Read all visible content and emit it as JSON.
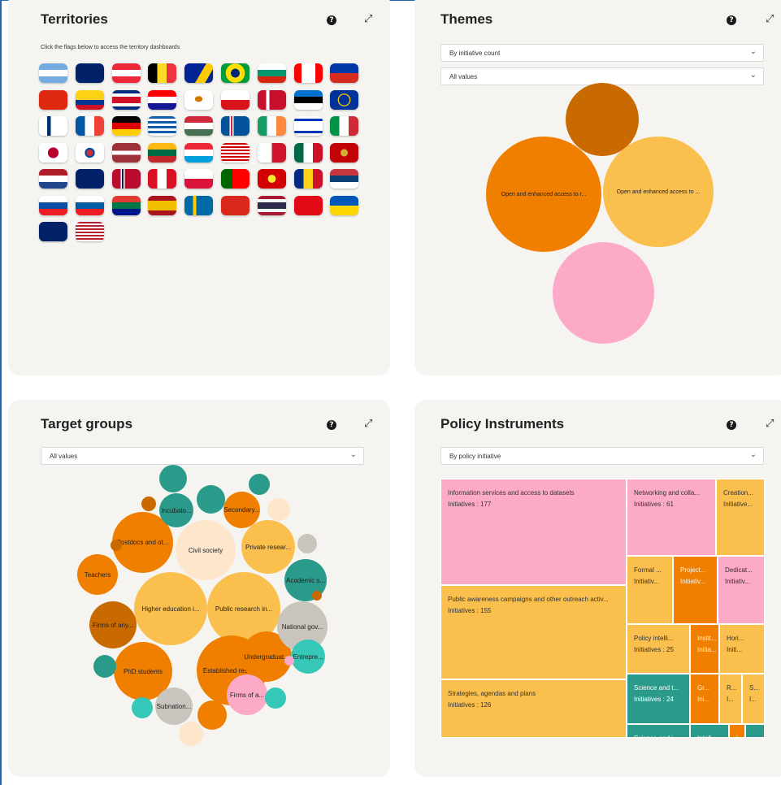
{
  "territories": {
    "title": "Territories",
    "hint": "Click the flags below to access the territory dashboards",
    "flags": [
      {
        "name": "flag-argentina",
        "bg": "linear-gradient(#74acdf 33%,#fff 33% 66%,#74acdf 66%)"
      },
      {
        "name": "flag-australia",
        "bg": "#012169"
      },
      {
        "name": "flag-austria",
        "bg": "linear-gradient(#ed2939 33%,#fff 33% 66%,#ed2939 66%)"
      },
      {
        "name": "flag-belgium",
        "bg": "linear-gradient(90deg,#000 33%,#fdda24 33% 66%,#ef3340 66%)"
      },
      {
        "name": "flag-bosnia",
        "bg": "linear-gradient(120deg,#002395 55%,#fecb00 55% 80%,#002395 80%)"
      },
      {
        "name": "flag-brazil",
        "bg": "radial-gradient(circle,#002776 25%,#fedf00 26% 55%,#009c3b 56%)"
      },
      {
        "name": "flag-bulgaria",
        "bg": "linear-gradient(#fff 33%,#00966e 33% 66%,#d62612 66%)"
      },
      {
        "name": "flag-canada",
        "bg": "linear-gradient(90deg,#ff0000 25%,#fff 25% 75%,#ff0000 75%)"
      },
      {
        "name": "flag-chile",
        "bg": "linear-gradient(#0039a6 50%,#d52b1e 50%)"
      },
      {
        "name": "flag-china",
        "bg": "#de2910"
      },
      {
        "name": "flag-colombia",
        "bg": "linear-gradient(#fcd116 50%,#003893 50% 75%,#ce1126 75%)"
      },
      {
        "name": "flag-costa-rica",
        "bg": "linear-gradient(#002b7f 17%,#fff 17% 33%,#ce1126 33% 67%,#fff 67% 83%,#002b7f 83%)"
      },
      {
        "name": "flag-croatia",
        "bg": "linear-gradient(#ff0000 33%,#fff 33% 66%,#171796 66%)"
      },
      {
        "name": "flag-cyprus",
        "bg": "radial-gradient(ellipse at 50% 45%,#d57800 18%,#fff 20%)"
      },
      {
        "name": "flag-czechia",
        "bg": "linear-gradient(#fff 50%,#d7141a 50%)"
      },
      {
        "name": "flag-denmark",
        "bg": "linear-gradient(90deg,#c8102e 30%,#fff 30% 42%,#c8102e 42%)"
      },
      {
        "name": "flag-estonia",
        "bg": "linear-gradient(#0072ce 33%,#000 33% 66%,#fff 66%)"
      },
      {
        "name": "flag-eu",
        "bg": "radial-gradient(circle,#003399 30%,#ffcc00 32% 36%,#003399 38%)"
      },
      {
        "name": "flag-finland",
        "bg": "linear-gradient(90deg,#fff 28%,#002f6c 28% 42%,#fff 42%)"
      },
      {
        "name": "flag-france",
        "bg": "linear-gradient(90deg,#0055a4 33%,#fff 33% 66%,#ef4135 66%)"
      },
      {
        "name": "flag-germany",
        "bg": "linear-gradient(#000 33%,#dd0000 33% 66%,#ffce00 66%)"
      },
      {
        "name": "flag-greece",
        "bg": "repeating-linear-gradient(#0d5eaf 0 3px,#fff 3px 6px)"
      },
      {
        "name": "flag-hungary",
        "bg": "linear-gradient(#ce2939 33%,#fff 33% 66%,#477050 66%)"
      },
      {
        "name": "flag-iceland",
        "bg": "linear-gradient(90deg,#02529c 30%,#fff 30% 34%,#dc1e35 34% 40%,#fff 40% 44%,#02529c 44%)"
      },
      {
        "name": "flag-ireland",
        "bg": "linear-gradient(90deg,#169b62 33%,#fff 33% 66%,#ff883e 66%)"
      },
      {
        "name": "flag-israel",
        "bg": "linear-gradient(#fff 12%,#0038b8 12% 24%,#fff 24% 76%,#0038b8 76% 88%,#fff 88%)"
      },
      {
        "name": "flag-italy",
        "bg": "linear-gradient(90deg,#009246 33%,#fff 33% 66%,#ce2b37 66%)"
      },
      {
        "name": "flag-japan",
        "bg": "radial-gradient(circle,#bc002d 30%,#fff 32%)"
      },
      {
        "name": "flag-korea",
        "bg": "radial-gradient(circle,#cd2e3a 18%,#0047a0 20% 28%,#fff 30%)"
      },
      {
        "name": "flag-latvia",
        "bg": "linear-gradient(#9e3039 40%,#fff 40% 60%,#9e3039 60%)"
      },
      {
        "name": "flag-lithuania",
        "bg": "linear-gradient(#fdb913 33%,#006a44 33% 66%,#c1272d 66%)"
      },
      {
        "name": "flag-luxembourg",
        "bg": "linear-gradient(#ed2939 33%,#fff 33% 66%,#00a1de 66%)"
      },
      {
        "name": "flag-malaysia",
        "bg": "repeating-linear-gradient(#cc0001 0 2px,#fff 2px 4px)"
      },
      {
        "name": "flag-malta",
        "bg": "linear-gradient(90deg,#fff 50%,#cf142b 50%)"
      },
      {
        "name": "flag-mexico",
        "bg": "linear-gradient(90deg,#006847 33%,#fff 33% 66%,#ce1126 66%)"
      },
      {
        "name": "flag-montenegro",
        "bg": "radial-gradient(circle,#d4af37 20%,#c40308 22%)"
      },
      {
        "name": "flag-netherlands",
        "bg": "linear-gradient(#ae1c28 33%,#fff 33% 66%,#21468b 66%)"
      },
      {
        "name": "flag-new-zealand",
        "bg": "#012169"
      },
      {
        "name": "flag-norway",
        "bg": "linear-gradient(90deg,#ba0c2f 30%,#fff 30% 34%,#00205b 34% 40%,#fff 40% 44%,#ba0c2f 44%)"
      },
      {
        "name": "flag-peru",
        "bg": "linear-gradient(90deg,#d91023 33%,#fff 33% 66%,#d91023 66%)"
      },
      {
        "name": "flag-poland",
        "bg": "linear-gradient(#fff 50%,#dc143c 50%)"
      },
      {
        "name": "flag-portugal",
        "bg": "linear-gradient(90deg,#006600 40%,#ff0000 40%)"
      },
      {
        "name": "flag-north-macedonia",
        "bg": "radial-gradient(circle,#f8e92e 22%,#d20000 24%)"
      },
      {
        "name": "flag-romania",
        "bg": "linear-gradient(90deg,#002b7f 33%,#fcd116 33% 66%,#ce1126 66%)"
      },
      {
        "name": "flag-serbia",
        "bg": "linear-gradient(#c6363c 33%,#0c4076 33% 66%,#fff 66%)"
      },
      {
        "name": "flag-slovakia",
        "bg": "linear-gradient(#fff 33%,#0b4ea2 33% 66%,#ee1c25 66%)"
      },
      {
        "name": "flag-slovenia",
        "bg": "linear-gradient(#fff 33%,#005da4 33% 66%,#ed1c24 66%)"
      },
      {
        "name": "flag-south-africa",
        "bg": "linear-gradient(#e03c31 33%,#007749 33% 66%,#001489 66%)"
      },
      {
        "name": "flag-spain",
        "bg": "linear-gradient(#aa151b 25%,#f1bf00 25% 75%,#aa151b 75%)"
      },
      {
        "name": "flag-sweden",
        "bg": "linear-gradient(90deg,#006aa7 30%,#fecc00 30% 42%,#006aa7 42%)"
      },
      {
        "name": "flag-switzerland",
        "bg": "#da291c"
      },
      {
        "name": "flag-thailand",
        "bg": "linear-gradient(#a51931 17%,#f4f5f8 17% 33%,#2d2a4a 33% 67%,#f4f5f8 67% 83%,#a51931 83%)"
      },
      {
        "name": "flag-turkey",
        "bg": "#e30a17"
      },
      {
        "name": "flag-ukraine",
        "bg": "linear-gradient(#0057b7 50%,#ffd700 50%)"
      },
      {
        "name": "flag-uk",
        "bg": "#012169"
      },
      {
        "name": "flag-usa",
        "bg": "repeating-linear-gradient(#b22234 0 2px,#fff 2px 4px)"
      }
    ]
  },
  "themes": {
    "title": "Themes",
    "select1": "By initiative count",
    "select2": "All values",
    "bubbles": [
      {
        "name": "theme-bubble-top",
        "label": "",
        "color": "#c96a00"
      },
      {
        "name": "theme-bubble-left",
        "label": "Open and enhanced access to r...",
        "color": "#f07f00"
      },
      {
        "name": "theme-bubble-right",
        "label": "Open and enhanced access to ...",
        "color": "#fbbf4d"
      },
      {
        "name": "theme-bubble-bottom",
        "label": "",
        "color": "#fdaac8"
      }
    ]
  },
  "target_groups": {
    "title": "Target groups",
    "select": "All values",
    "bubbles": [
      {
        "label": "Civil society",
        "color": "#fde6cc"
      },
      {
        "label": "Higher education i...",
        "color": "#fbbf4d"
      },
      {
        "label": "Public research in...",
        "color": "#fbbf4d"
      },
      {
        "label": "Established resea...",
        "color": "#f07f00"
      },
      {
        "label": "PhD students",
        "color": "#f07f00"
      },
      {
        "label": "Postdocs and ot...",
        "color": "#f07f00"
      },
      {
        "label": "Private resear...",
        "color": "#fbbf4d"
      },
      {
        "label": "Firms of any...",
        "color": "#c96a00"
      },
      {
        "label": "Undergraduat...",
        "color": "#f07f00"
      },
      {
        "label": "National gov...",
        "color": "#c9c5bd"
      },
      {
        "label": "Academic s...",
        "color": "#2a9a8a"
      },
      {
        "label": "Teachers",
        "color": "#f07f00"
      },
      {
        "label": "Secondary...",
        "color": "#f07f00"
      },
      {
        "label": "Incubato...",
        "color": "#2a9a8a"
      },
      {
        "label": "Subnation...",
        "color": "#c9c5bd"
      },
      {
        "label": "Firms of a...",
        "color": "#fdaac8"
      },
      {
        "label": "Entrepre...",
        "color": "#35c7b7"
      },
      {
        "label": "",
        "color": "#2a9a8a"
      },
      {
        "label": "",
        "color": "#2a9a8a"
      },
      {
        "label": "",
        "color": "#2a9a8a"
      },
      {
        "label": "",
        "color": "#fde6cc"
      },
      {
        "label": "",
        "color": "#c9c5bd"
      },
      {
        "label": "",
        "color": "#c96a00"
      },
      {
        "label": "",
        "color": "#c96a00"
      },
      {
        "label": "",
        "color": "#c96a00"
      },
      {
        "label": "",
        "color": "#2a9a8a"
      },
      {
        "label": "",
        "color": "#35c7b7"
      },
      {
        "label": "",
        "color": "#f07f00"
      },
      {
        "label": "",
        "color": "#fde6cc"
      },
      {
        "label": "",
        "color": "#35c7b7"
      },
      {
        "label": "",
        "color": "#fdaac8"
      }
    ]
  },
  "policy_instruments": {
    "title": "Policy Instruments",
    "select": "By policy initiative",
    "tiles": [
      {
        "label": "Information services and access to datasets",
        "value": "Initiatives : 177",
        "color": "#fdaac8"
      },
      {
        "label": "Networking and colla...",
        "value": "Initiatives : 61",
        "color": "#fdaac8"
      },
      {
        "label": "Creation...",
        "value": "Initiative...",
        "color": "#fbbf4d"
      },
      {
        "label": "Formal ...",
        "value": "Initiativ...",
        "color": "#fbbf4d"
      },
      {
        "label": "Project...",
        "value": "Initiativ...",
        "color": "#f07f00"
      },
      {
        "label": "Dedicat...",
        "value": "Initiativ...",
        "color": "#fdaac8"
      },
      {
        "label": "Public awareness campaigns and other outreach activ...",
        "value": "Initiatives : 155",
        "color": "#fbbf4d"
      },
      {
        "label": "Policy intelli...",
        "value": "Initiatives : 25",
        "color": "#fbbf4d"
      },
      {
        "label": "Instit...",
        "value": "Initia...",
        "color": "#f07f00"
      },
      {
        "label": "Hori...",
        "value": "Initi...",
        "color": "#fbbf4d"
      },
      {
        "label": "Science and t...",
        "value": "Initiatives : 24",
        "color": "#2a9a8a"
      },
      {
        "label": "Gr...",
        "value": "Ini...",
        "color": "#f07f00"
      },
      {
        "label": "R...",
        "value": "I...",
        "color": "#fbbf4d"
      },
      {
        "label": "S...",
        "value": "I...",
        "color": "#fbbf4d"
      },
      {
        "label": "Strategies, agendas and plans",
        "value": "Initiatives : 126",
        "color": "#fbbf4d"
      },
      {
        "label": "Science and i...",
        "value": "",
        "color": "#2a9a8a"
      },
      {
        "label": "Intell...",
        "value": "",
        "color": "#2a9a8a"
      },
      {
        "label": "i",
        "value": "",
        "color": "#f07f00"
      },
      {
        "label": "-",
        "value": "",
        "color": "#2a9a8a"
      }
    ]
  }
}
